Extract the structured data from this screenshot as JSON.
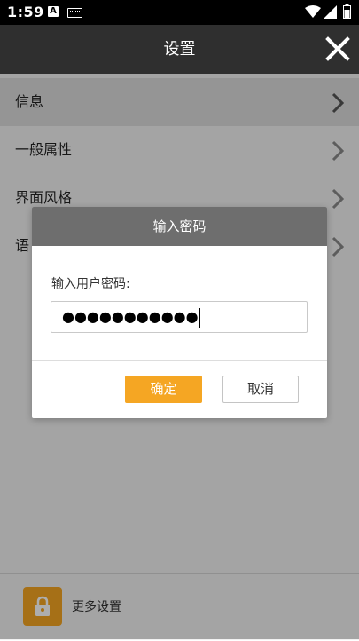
{
  "status_bar": {
    "time": "1:59",
    "notification_icons": [
      "a-notification-icon",
      "keyboard-icon"
    ],
    "system_icons": [
      "wifi-icon",
      "signal-icon",
      "battery-icon"
    ]
  },
  "appbar": {
    "title": "设置",
    "close_icon": "close-icon"
  },
  "list": {
    "items": [
      {
        "label": "信息",
        "active": true
      },
      {
        "label": "一般属性",
        "active": false
      },
      {
        "label": "界面风格",
        "active": false
      },
      {
        "label": "语",
        "active": false
      }
    ],
    "chevron_icon": "chevron-right-icon"
  },
  "bottom": {
    "lock_icon": "lock-icon",
    "more_label": "更多设置"
  },
  "dialog": {
    "title": "输入密码",
    "prompt": "输入用户密码:",
    "password_value": "●●●●●●●●●●●",
    "ok_label": "确定",
    "cancel_label": "取消"
  },
  "colors": {
    "accent": "#f5a623",
    "appbar": "#2f2f2f",
    "dialog_title": "#6e6e6e"
  }
}
